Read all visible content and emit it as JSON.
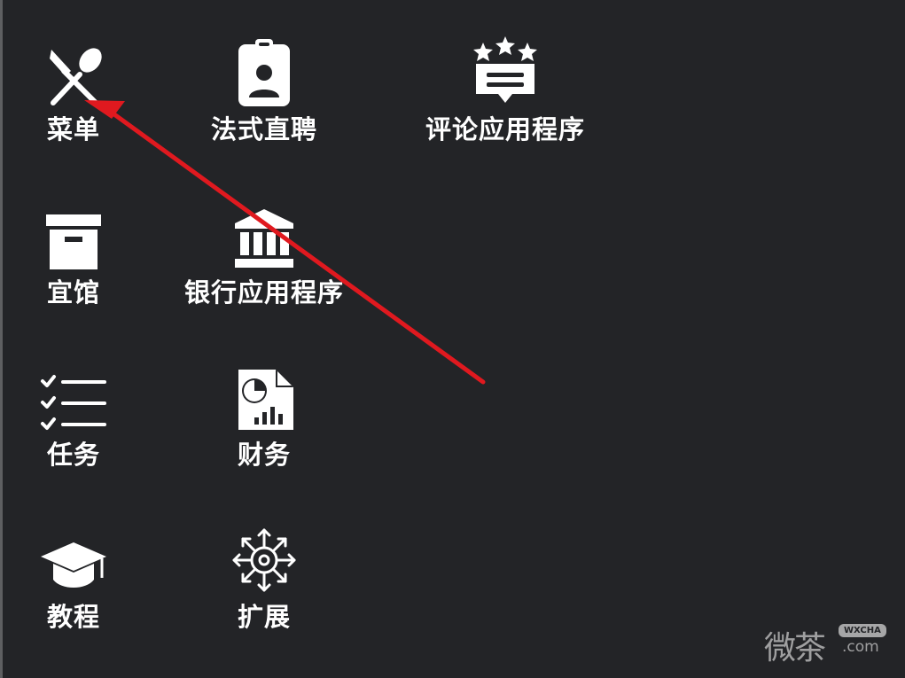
{
  "apps": [
    {
      "label": "菜单",
      "icon": "fork-spoon-icon"
    },
    {
      "label": "法式直聘",
      "icon": "id-badge-icon"
    },
    {
      "label": "评论应用程序",
      "icon": "review-stars-icon"
    },
    {
      "label": "宜馆",
      "icon": "archive-box-icon"
    },
    {
      "label": "银行应用程序",
      "icon": "bank-icon"
    },
    {
      "label": "任务",
      "icon": "checklist-icon"
    },
    {
      "label": "财务",
      "icon": "finance-report-icon"
    },
    {
      "label": "教程",
      "icon": "graduation-cap-icon"
    },
    {
      "label": "扩展",
      "icon": "expand-arrows-icon"
    }
  ],
  "annotation": {
    "type": "arrow",
    "color": "#e0191f",
    "points_to": "菜单"
  },
  "watermark": {
    "text": "微茶",
    "badge": "WXCHA",
    "domain": ".com"
  },
  "colors": {
    "background": "#232427",
    "icon": "#ffffff",
    "text": "#ffffff"
  }
}
